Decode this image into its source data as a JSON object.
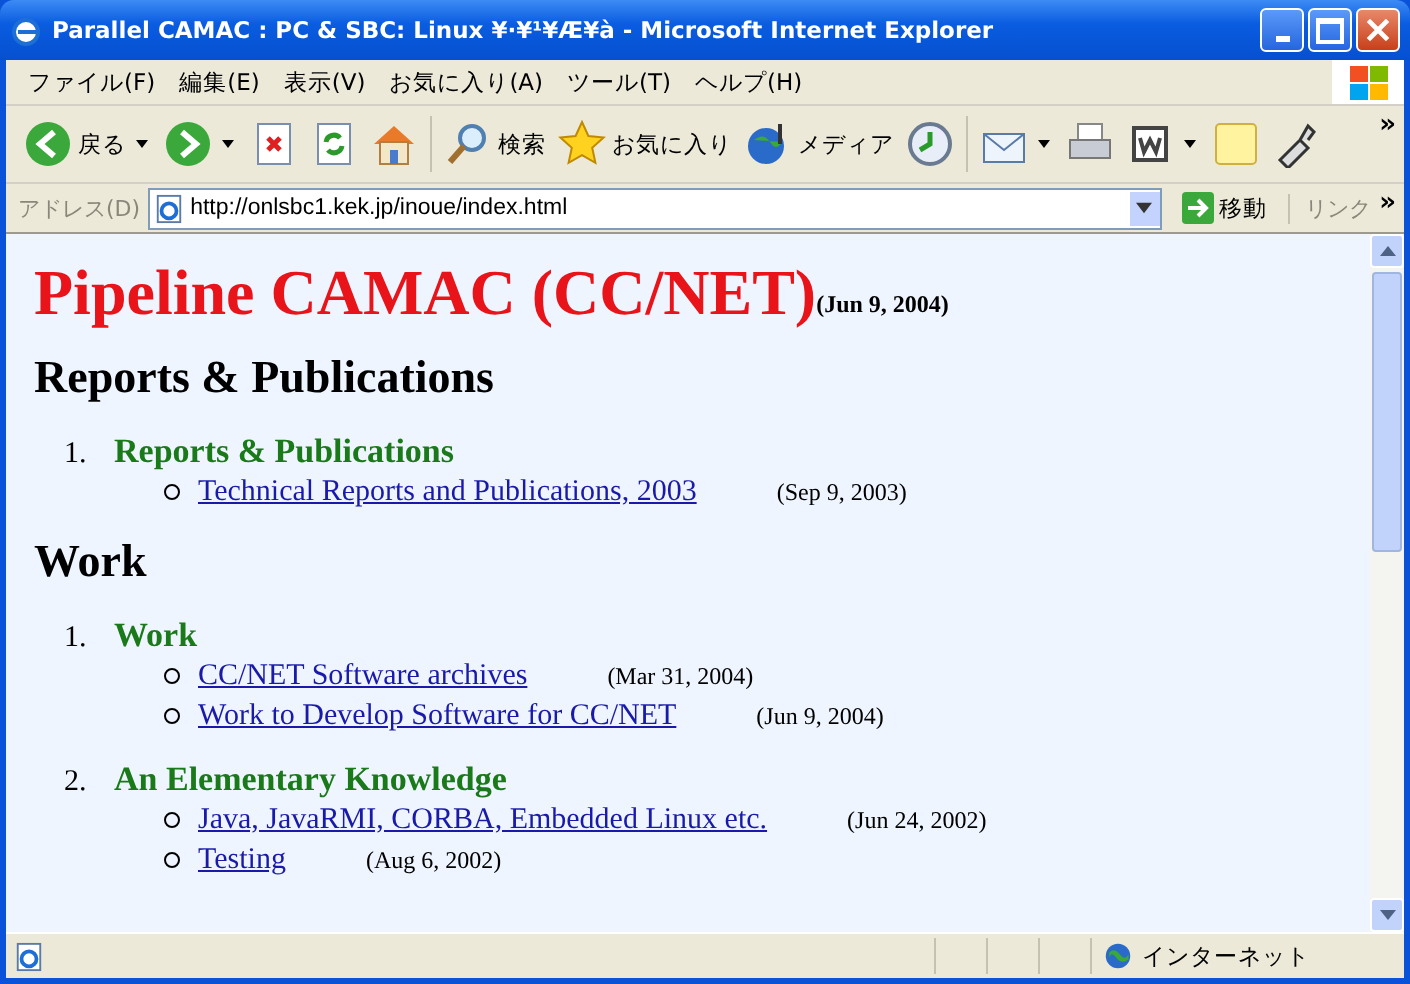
{
  "window": {
    "title": "Parallel CAMAC : PC & SBC: Linux ¥·¥¹¥Æ¥à - Microsoft Internet Explorer"
  },
  "menu": [
    "ファイル(F)",
    "編集(E)",
    "表示(V)",
    "お気に入り(A)",
    "ツール(T)",
    "ヘルプ(H)"
  ],
  "toolbar": [
    {
      "kind": "back",
      "label": "戻る"
    },
    {
      "kind": "forward"
    },
    {
      "kind": "stop"
    },
    {
      "kind": "refresh"
    },
    {
      "kind": "home"
    },
    {
      "kind": "search",
      "label": "検索"
    },
    {
      "kind": "favorites",
      "label": "お気に入り"
    },
    {
      "kind": "media",
      "label": "メディア"
    },
    {
      "kind": "history"
    },
    {
      "kind": "mail"
    },
    {
      "kind": "print"
    },
    {
      "kind": "edit"
    },
    {
      "kind": "note"
    },
    {
      "kind": "tool"
    }
  ],
  "toolbar_overflow": "»",
  "address": {
    "label": "アドレス(D)",
    "url": "http://onlsbc1.kek.jp/inoue/index.html",
    "go": "移動",
    "links": "リンク",
    "links_overflow": "»"
  },
  "page": {
    "title": "Pipeline CAMAC (CC/NET)",
    "date": "(Jun 9, 2004)",
    "sections": [
      {
        "heading": "Reports & Publications",
        "items": [
          {
            "number": "1.",
            "title": "Reports & Publications",
            "links": [
              {
                "text": "Technical Reports and Publications, 2003",
                "date": "(Sep 9, 2003)"
              }
            ]
          }
        ]
      },
      {
        "heading": "Work",
        "items": [
          {
            "number": "1.",
            "title": "Work",
            "links": [
              {
                "text": "CC/NET Software archives",
                "date": "(Mar 31, 2004)"
              },
              {
                "text": "Work to Develop Software for CC/NET",
                "date": "(Jun 9, 2004)"
              }
            ]
          },
          {
            "number": "2.",
            "title": "An Elementary Knowledge",
            "links": [
              {
                "text": "Java, JavaRMI, CORBA, Embedded Linux etc.",
                "date": "(Jun 24, 2002)"
              },
              {
                "text": "Testing",
                "date": "(Aug 6, 2002)"
              }
            ]
          }
        ]
      }
    ]
  },
  "status_bar": {
    "zone": "インターネット"
  }
}
